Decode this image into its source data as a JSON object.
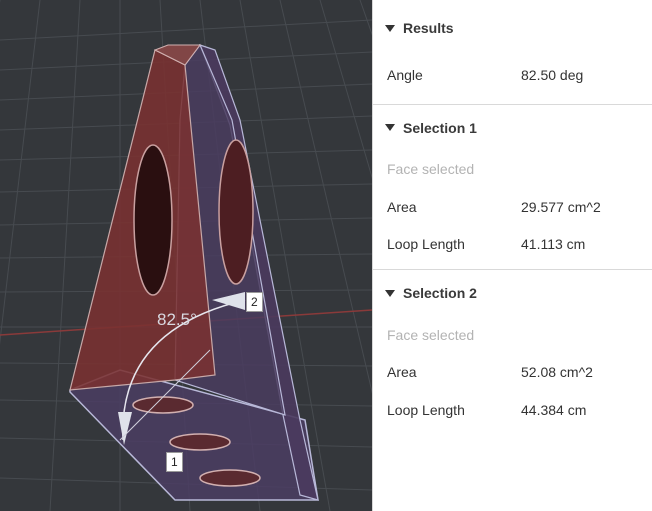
{
  "viewport": {
    "angle_annotation": "82.5°",
    "marker_1": "1",
    "marker_2": "2"
  },
  "panel": {
    "results": {
      "title": "Results",
      "angle_label": "Angle",
      "angle_value": "82.50 deg"
    },
    "selection1": {
      "title": "Selection 1",
      "status": "Face selected",
      "area_label": "Area",
      "area_value": "29.577 cm^2",
      "loop_label": "Loop Length",
      "loop_value": "41.113 cm"
    },
    "selection2": {
      "title": "Selection 2",
      "status": "Face selected",
      "area_label": "Area",
      "area_value": "52.08 cm^2",
      "loop_label": "Loop Length",
      "loop_value": "44.384 cm"
    }
  },
  "icons": {
    "caret": "caret-down-icon"
  },
  "colors": {
    "viewport_bg": "#34373b",
    "grid": "#4b4f54",
    "face_red": "#7a3030",
    "face_purple": "#4a3a5e",
    "axis_red": "#8a3a3a"
  }
}
